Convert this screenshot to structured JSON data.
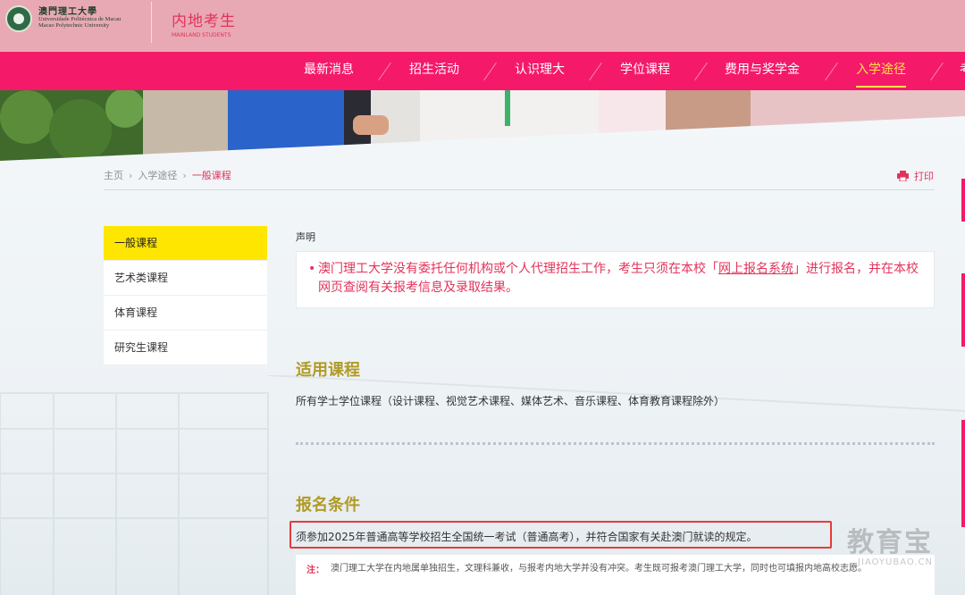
{
  "header": {
    "logo": {
      "name_cn": "澳門理工大學",
      "name_pt": "Universidade Politécnica de Macau",
      "name_en": "Macao Polytechnic University"
    },
    "section_cn": "内地考生",
    "section_en": "MAINLAND STUDENTS"
  },
  "nav": {
    "items": [
      {
        "label": "最新消息"
      },
      {
        "label": "招生活动"
      },
      {
        "label": "认识理大"
      },
      {
        "label": "学位课程"
      },
      {
        "label": "费用与奖学金"
      },
      {
        "label": "入学途径"
      },
      {
        "label": "考"
      }
    ],
    "active_index": 5
  },
  "breadcrumb": {
    "home": "主页",
    "level1": "入学途径",
    "current": "一般课程"
  },
  "print_label": "打印",
  "sidebar": {
    "items": [
      {
        "label": "一般课程"
      },
      {
        "label": "艺术类课程"
      },
      {
        "label": "体育课程"
      },
      {
        "label": "研究生课程"
      }
    ],
    "active_index": 0
  },
  "notice": {
    "title": "声明",
    "bullet": "•",
    "text_before": "澳门理工大学没有委托任何机构或个人代理招生工作，考生只须在本校「",
    "link": "网上报名系统",
    "text_after": "」进行报名，并在本校网页查阅有关报考信息及录取结果。"
  },
  "applicable": {
    "heading": "适用课程",
    "text": "所有学士学位课程（设计课程、视觉艺术课程、媒体艺术、音乐课程、体育教育课程除外）"
  },
  "requirements": {
    "heading": "报名条件",
    "text": "须参加2025年普通高等学校招生全国统一考试（普通高考），并符合国家有关赴澳门就读的规定。",
    "note_label": "注：",
    "note_text": "澳门理工大学在内地属单独招生，文理科兼收，与报考内地大学并没有冲突。考生既可报考澳门理工大学，同时也可填报内地高校志愿。"
  },
  "watermark": {
    "cn": "教育宝",
    "en": "JIAOYUBAO.CN"
  },
  "colors": {
    "nav_bg": "#f5196a",
    "top_bg": "#e8a9b4",
    "accent_pink": "#e2335a",
    "active_nav": "#ffe24a",
    "sidebar_active": "#ffe600",
    "heading_gold": "#b09b26",
    "highlight_red": "#e83a3a"
  },
  "icons": {
    "logo": "university-seal-icon",
    "print": "printer-icon"
  }
}
